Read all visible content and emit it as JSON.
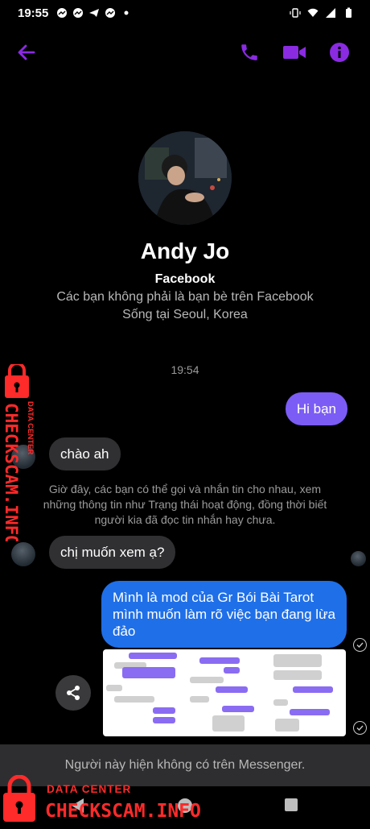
{
  "status": {
    "time": "19:55"
  },
  "header": {
    "back_icon": "arrow-left-icon",
    "call_icon": "phone-icon",
    "video_icon": "video-icon",
    "info_icon": "info-icon",
    "accent_color": "#8a2be2"
  },
  "profile": {
    "name": "Andy Jo",
    "source": "Facebook",
    "friend_status": "Các bạn không phải là bạn bè trên Facebook",
    "location": "Sống tại Seoul, Korea"
  },
  "conversation": {
    "timestamp": "19:54",
    "messages": [
      {
        "text": "Hi bạn"
      },
      {
        "text": "chào ah"
      },
      {
        "text": "chị muốn xem ạ?"
      },
      {
        "text": "Mình là mod của Gr Bói Bài Tarot mình muốn làm rõ việc bạn đang lừa đảo"
      }
    ],
    "notice": "Giờ đây, các bạn có thể gọi và nhắn tin cho nhau, xem những thông tin như Trạng thái hoạt động, đồng thời biết người kia đã đọc tin nhắn hay chưa.",
    "colors": {
      "outgoing": "#7b5cf5",
      "incoming": "#303033",
      "blue": "#1f6fe8"
    }
  },
  "footer": {
    "unavailable_text": "Người này hiện không có trên Messenger."
  },
  "watermark": {
    "label_top": "DATA CENTER",
    "label_main": "CHECKSCAM.INFO",
    "color": "#ff2a2a"
  }
}
